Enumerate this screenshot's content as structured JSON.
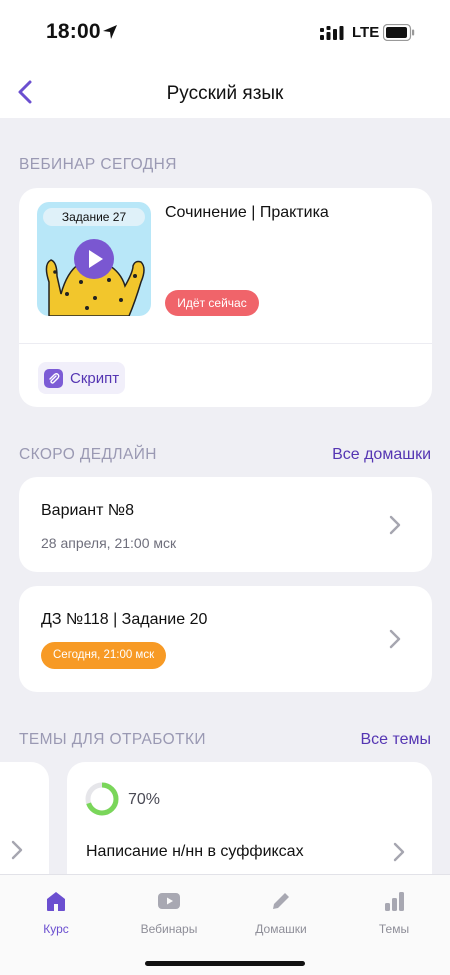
{
  "status_bar": {
    "time": "18:00",
    "network": "LTE",
    "location_icon": "location-arrow-icon",
    "signal_icon": "signal-icon",
    "battery_icon": "battery-icon"
  },
  "nav": {
    "title": "Русский язык",
    "back_icon": "chevron-left-icon"
  },
  "webinar_section": {
    "title": "ВЕБИНАР СЕГОДНЯ",
    "card": {
      "thumbnail_label": "Задание 27",
      "name": "Сочинение | Практика",
      "status": "Идёт сейчас",
      "script_label": "Скрипт"
    }
  },
  "deadline_section": {
    "title": "СКОРО ДЕДЛАЙН",
    "link": "Все домашки",
    "items": [
      {
        "title": "Вариант №8",
        "date": "28 апреля, 21:00 мск"
      },
      {
        "title": "ДЗ №118 | Задание 20",
        "badge": "Сегодня, 21:00 мск"
      }
    ]
  },
  "topics_section": {
    "title": "ТЕМЫ ДЛЯ ОТРАБОТКИ",
    "link": "Все темы",
    "items": [
      {
        "progress_label": "70%",
        "progress": 0.7,
        "name": "Написание н/нн в суффиксах"
      }
    ]
  },
  "tabbar": {
    "tabs": [
      {
        "label": "Курс",
        "icon": "home-icon",
        "active": true
      },
      {
        "label": "Вебинары",
        "icon": "video-play-icon",
        "active": false
      },
      {
        "label": "Домашки",
        "icon": "pencil-icon",
        "active": false
      },
      {
        "label": "Темы",
        "icon": "bar-chart-icon",
        "active": false
      }
    ]
  },
  "colors": {
    "accent": "#6b4fd0",
    "link": "#5536b3",
    "live_badge": "#f0646a",
    "deadline_badge": "#f79a25",
    "progress": "#7ad65a",
    "background": "#efeff4"
  }
}
